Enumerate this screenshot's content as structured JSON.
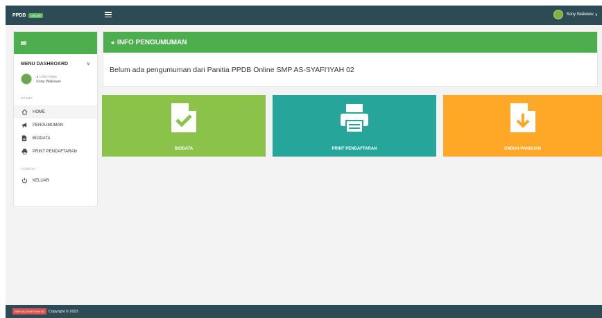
{
  "topbar": {
    "brand": "PPDB",
    "badge": "ONLINE",
    "user_name": "Sony Wakwaw",
    "user_caret": "∨"
  },
  "sidebar": {
    "menu_title": "MENU DASHBOARD",
    "chevron": "∨",
    "profile_role": "Calon Siswa",
    "profile_name": "Sony Wakwaw",
    "section_utama": "UTAMA",
    "section_lainnya": "LAINNYA",
    "items": [
      {
        "label": "HOME",
        "icon": "home-icon"
      },
      {
        "label": "PENGUMUMAN",
        "icon": "bullhorn-icon"
      },
      {
        "label": "BIODATA",
        "icon": "file-icon"
      },
      {
        "label": "PRINT PENDAFTARAN",
        "icon": "print-icon"
      },
      {
        "label": "KELUAR",
        "icon": "power-icon"
      }
    ]
  },
  "info": {
    "title": "INFO PENGUMUMAN",
    "message": "Belum ada pengumuman dari Panitia PPDB Online SMP AS-SYAFI'IYAH 02"
  },
  "tiles": [
    {
      "label": "BIODATA",
      "icon": "file-check-icon",
      "color": "#8bc34a"
    },
    {
      "label": "PRINT PENDAFTARAN",
      "icon": "printer-icon",
      "color": "#26a69a"
    },
    {
      "label": "UNDUH PANDUAN",
      "icon": "file-download-icon",
      "color": "#ffa726"
    }
  ],
  "footer": {
    "badge": "SMP AS-SYAFI'IYAH 02",
    "copyright": "Copyright © 2023"
  },
  "colors": {
    "header": "#2d4a55",
    "accent_green": "#4cae4c",
    "badge_red": "#d9534f"
  }
}
